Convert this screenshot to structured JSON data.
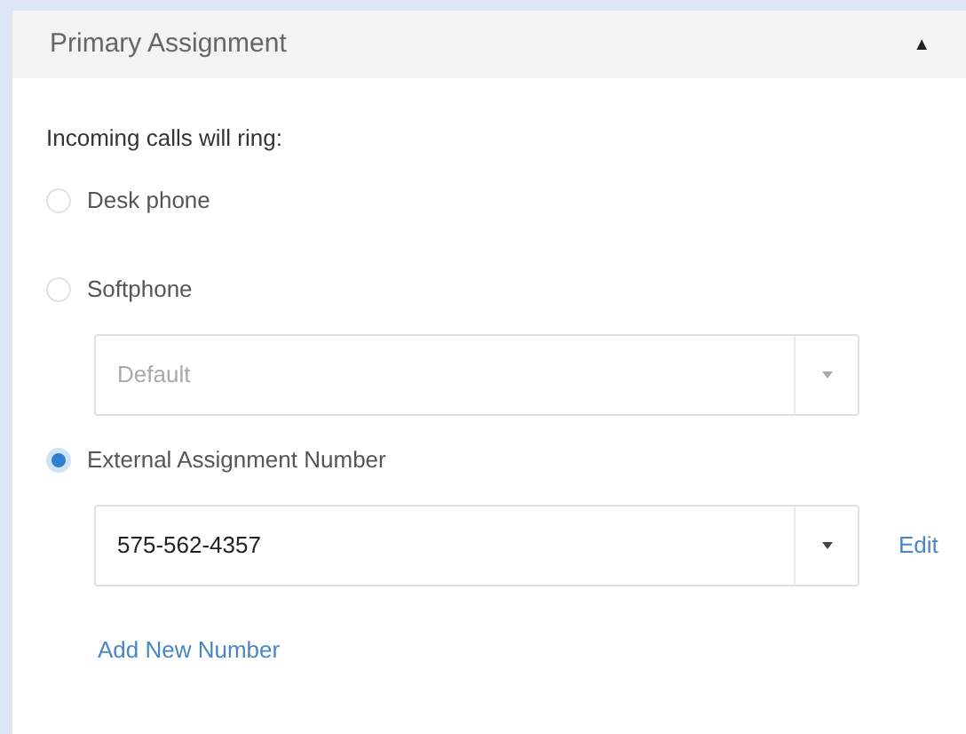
{
  "panel": {
    "title": "Primary Assignment",
    "collapse_icon": "▲",
    "expanded": true
  },
  "prompt": "Incoming calls will ring:",
  "options": [
    {
      "label": "Desk phone",
      "selected": false
    },
    {
      "label": "Softphone",
      "selected": false,
      "dropdown": {
        "value": "Default",
        "disabled": true
      }
    },
    {
      "label": "External Assignment Number",
      "selected": true,
      "dropdown": {
        "value": "575-562-4357",
        "disabled": false
      },
      "link": "Edit"
    }
  ],
  "add_link": "Add New Number"
}
